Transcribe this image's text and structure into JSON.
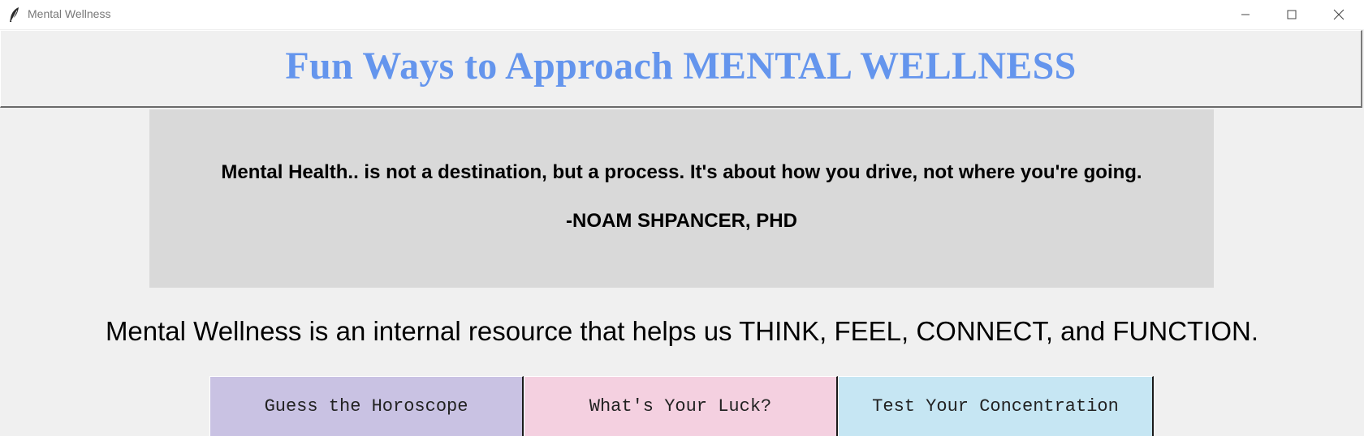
{
  "window": {
    "title": "Mental Wellness",
    "icon": "feather-icon"
  },
  "header": {
    "title": "Fun Ways to Approach MENTAL WELLNESS",
    "title_color": "#6495ed"
  },
  "quote": {
    "text": "Mental Health.. is not a destination, but a process. It's about how you drive, not where you're going.",
    "author": "-NOAM SHPANCER, PHD",
    "background": "#d9d9d9"
  },
  "description": "Mental Wellness is an internal resource that helps us THINK, FEEL, CONNECT, and FUNCTION.",
  "buttons": [
    {
      "label": "Guess the Horoscope",
      "color": "#c9c2e3"
    },
    {
      "label": "What's Your Luck?",
      "color": "#f4d0e0"
    },
    {
      "label": "Test Your Concentration",
      "color": "#c6e6f3"
    }
  ]
}
